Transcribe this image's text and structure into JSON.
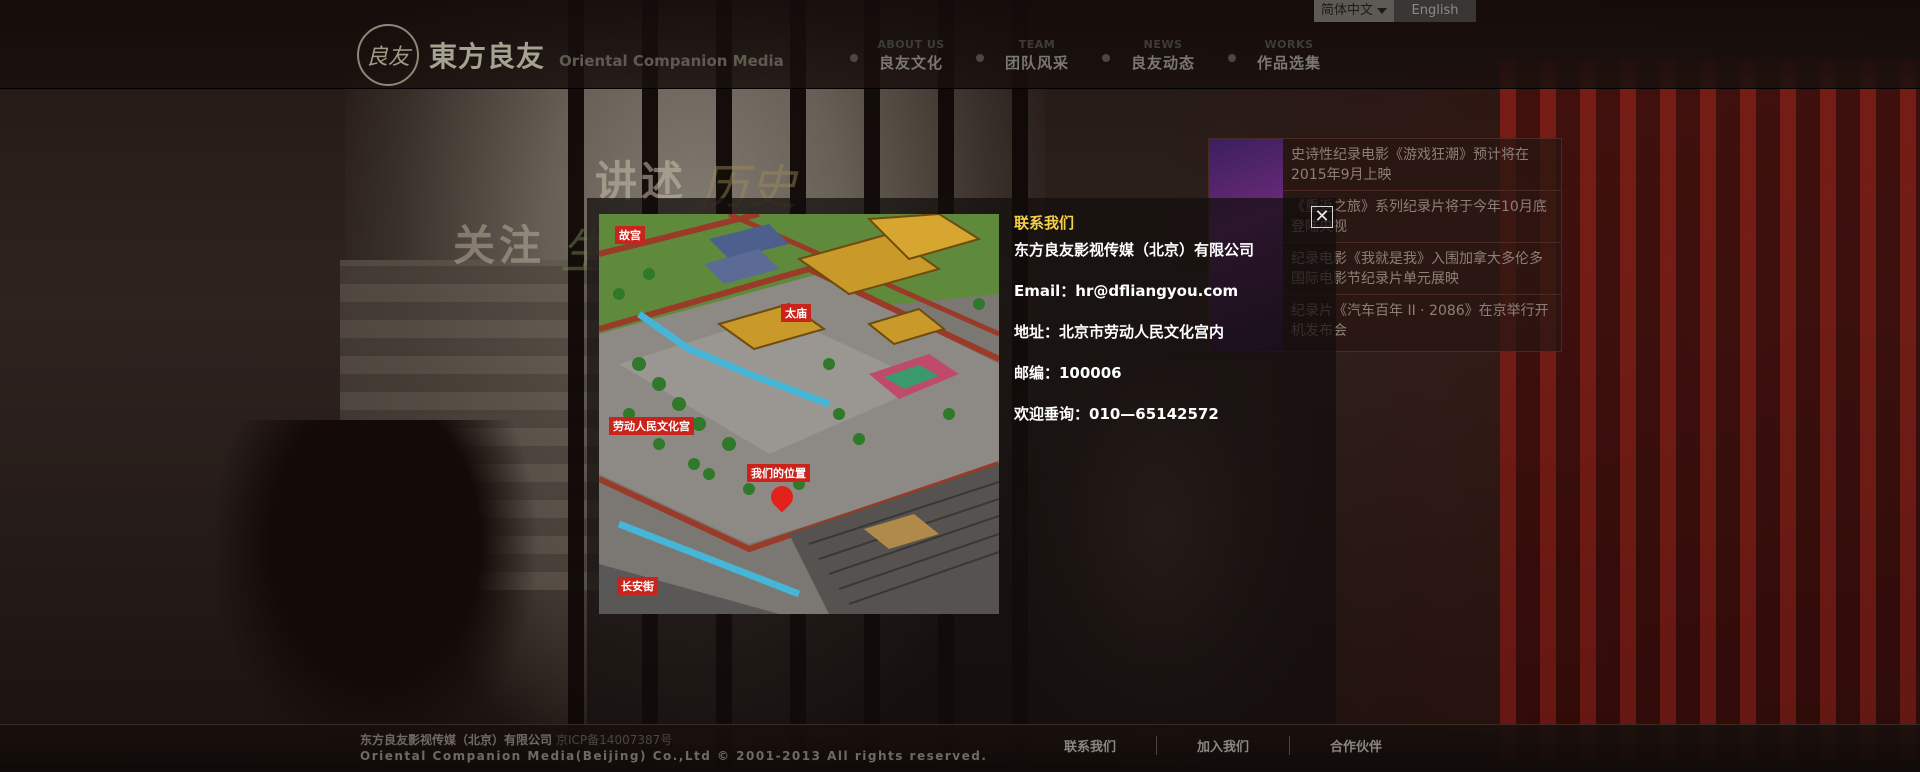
{
  "brand": {
    "logo_mark": "良友",
    "name_cn": "東方良友",
    "name_en": "Oriental Companion Media"
  },
  "language": {
    "current": "简体中文",
    "alternate": "English"
  },
  "nav": [
    {
      "en": "ABOUT US",
      "cn": "良友文化"
    },
    {
      "en": "TEAM",
      "cn": "团队风采"
    },
    {
      "en": "NEWS",
      "cn": "良友动态"
    },
    {
      "en": "WORKS",
      "cn": "作品选集"
    }
  ],
  "hero": {
    "line1": "讲述",
    "line1_accent": "历史",
    "line2": "关注",
    "line2_accent": "生"
  },
  "news": [
    "史诗性纪录电影《游戏狂潮》预计将在2015年9月上映",
    "《重返之旅》系列纪录片将于今年10月底登陆央视",
    "纪录电影《我就是我》入围加拿大多伦多国际电影节纪录片单元展映",
    "纪录片《汽车百年 II · 2086》在京举行开机发布会"
  ],
  "modal": {
    "close_symbol": "✕",
    "map_labels": {
      "gugong": "故宫",
      "taimiao": "太庙",
      "wenhuagong": "劳动人民文化宫",
      "location": "我们的位置",
      "changanjie": "长安街"
    },
    "title": "联系我们",
    "company": "东方良友影视传媒（北京）有限公司",
    "email": "Email：hr@dfliangyou.com",
    "address": "地址：北京市劳动人民文化宫内",
    "postcode": "邮编：100006",
    "phone": "欢迎垂询：010—65142572"
  },
  "footer": {
    "company": "东方良友影视传媒（北京）有限公司",
    "icp": "京ICP备14007387号",
    "copyright": "Oriental Companion Media(Beijing) Co.,Ltd © 2001-2013 All rights reserved.",
    "links": [
      "联系我们",
      "加入我们",
      "合作伙伴"
    ]
  },
  "colors": {
    "accent_title": "#f6cf4a",
    "map_label_bg": "#c8241b"
  }
}
